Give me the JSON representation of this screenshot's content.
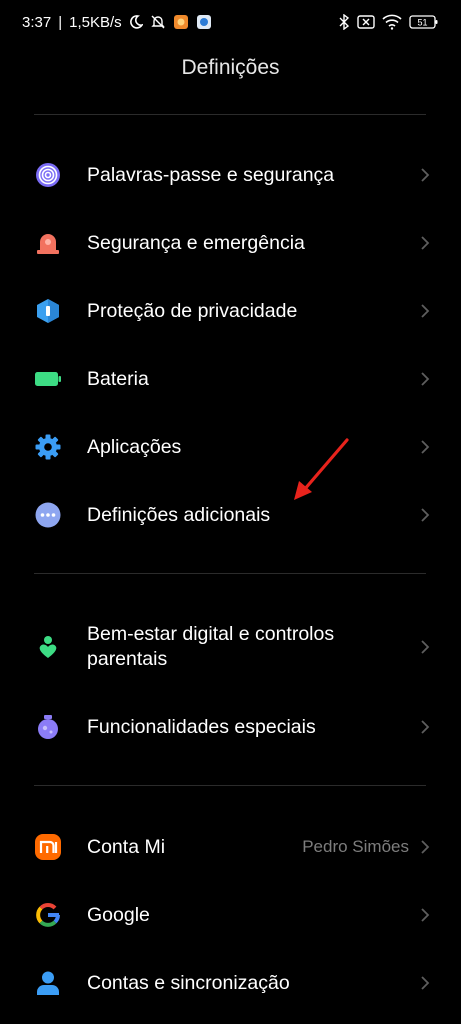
{
  "status_bar": {
    "time": "3:37",
    "network_speed": "1,5KB/s",
    "battery_level": "51"
  },
  "title": "Definições",
  "groups": [
    [
      {
        "name": "passwords-security",
        "label": "Palavras-passe e segurança",
        "icon": "fingerprint-icon",
        "color": "#7b6cf6"
      },
      {
        "name": "safety-emergency",
        "label": "Segurança e emergência",
        "icon": "emergency-light-icon",
        "color": "#f2725f"
      },
      {
        "name": "privacy-protection",
        "label": "Proteção de privacidade",
        "icon": "privacy-shield-icon",
        "color": "#3ba0f0"
      },
      {
        "name": "battery",
        "label": "Bateria",
        "icon": "battery-icon",
        "color": "#3ddc84"
      },
      {
        "name": "apps",
        "label": "Aplicações",
        "icon": "gear-icon",
        "color": "#3b9df5"
      },
      {
        "name": "additional-settings",
        "label": "Definições adicionais",
        "icon": "more-dots-icon",
        "color": "#8ea6f0"
      }
    ],
    [
      {
        "name": "digital-wellbeing",
        "label": "Bem-estar digital e controlos parentais",
        "icon": "wellbeing-icon",
        "color": "#3ddc84"
      },
      {
        "name": "special-features",
        "label": "Funcionalidades especiais",
        "icon": "potion-icon",
        "color": "#8b7cf6"
      }
    ],
    [
      {
        "name": "mi-account",
        "label": "Conta Mi",
        "value": "Pedro Simões",
        "icon": "mi-logo-icon",
        "color": "#ff6a00"
      },
      {
        "name": "google",
        "label": "Google",
        "icon": "google-icon",
        "color": "#4285f4"
      },
      {
        "name": "accounts-sync",
        "label": "Contas e sincronização",
        "icon": "person-icon",
        "color": "#3b9df5"
      }
    ]
  ],
  "annotation": {
    "arrow_color": "#e8231c"
  }
}
